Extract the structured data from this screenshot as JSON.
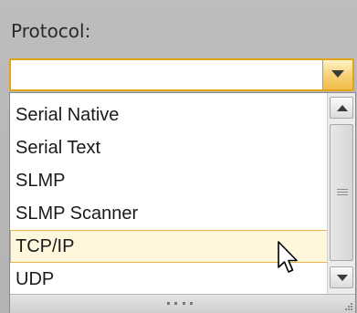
{
  "field": {
    "label": "Protocol:",
    "value": ""
  },
  "dropdown": {
    "items": [
      {
        "label": "Serial Native"
      },
      {
        "label": "Serial Text"
      },
      {
        "label": "SLMP"
      },
      {
        "label": "SLMP Scanner"
      },
      {
        "label": "TCP/IP"
      },
      {
        "label": "UDP"
      }
    ],
    "hovered_item": "TCP/IP"
  },
  "icons": {
    "combo_arrow": "chevron-down-icon",
    "scroll_up": "scroll-up-icon",
    "scroll_down": "scroll-down-icon",
    "resize_grip": "resize-grip-icon",
    "cursor": "mouse-pointer-icon"
  },
  "colors": {
    "accent_border": "#e2a316",
    "hover_fill": "#fff7dc",
    "hover_border": "#e9b44c"
  }
}
